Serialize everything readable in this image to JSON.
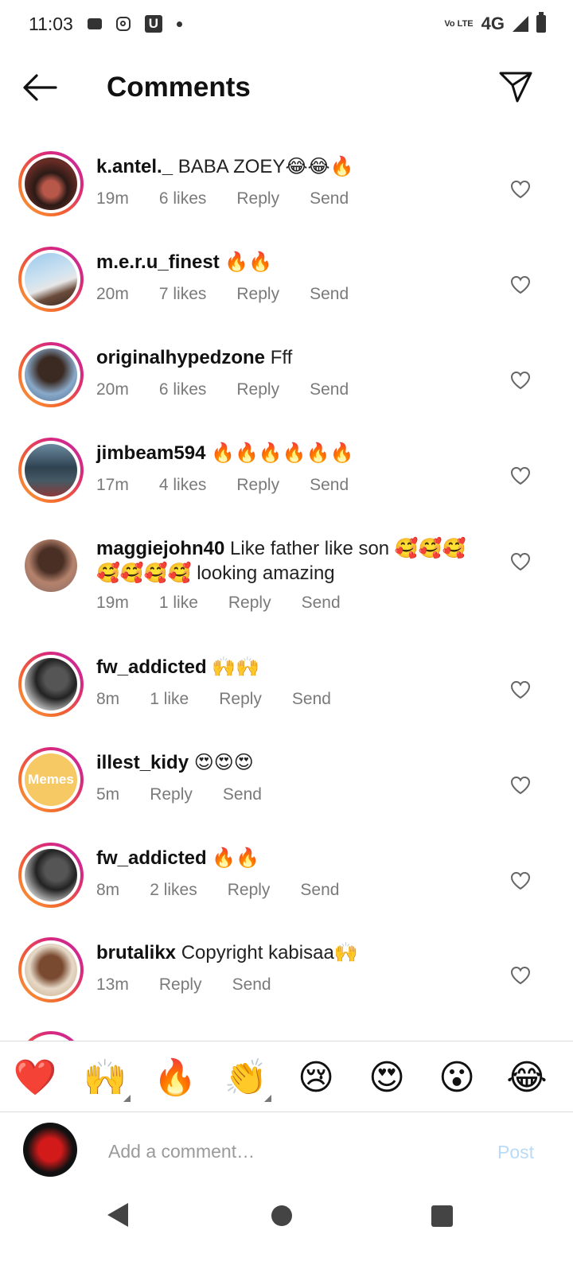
{
  "status_bar": {
    "time": "11:03",
    "network_label": "4G",
    "volte_label": "Vo LTE",
    "notification_icons": [
      "message-icon",
      "instagram-icon",
      "u-app-icon",
      "dot-icon"
    ],
    "system_icons": [
      "volte-icon",
      "signal-icon",
      "battery-icon"
    ]
  },
  "header": {
    "title": "Comments",
    "back_icon": "arrow-left-icon",
    "share_icon": "paper-plane-icon"
  },
  "comments": [
    {
      "username": "k.antel._",
      "text": "BABA ZOEY😂😂🔥",
      "time": "19m",
      "likes": "6 likes",
      "reply": "Reply",
      "send": "Send",
      "has_story_ring": true
    },
    {
      "username": "m.e.r.u_finest",
      "text": "🔥🔥",
      "time": "20m",
      "likes": "7 likes",
      "reply": "Reply",
      "send": "Send",
      "has_story_ring": true
    },
    {
      "username": "originalhypedzone",
      "text": "Fff",
      "time": "20m",
      "likes": "6 likes",
      "reply": "Reply",
      "send": "Send",
      "has_story_ring": true
    },
    {
      "username": "jimbeam594",
      "text": "🔥🔥🔥🔥🔥🔥",
      "time": "17m",
      "likes": "4 likes",
      "reply": "Reply",
      "send": "Send",
      "has_story_ring": true
    },
    {
      "username": "maggiejohn40",
      "text": "Like father like son 🥰🥰🥰🥰🥰🥰🥰 looking amazing",
      "time": "19m",
      "likes": "1 like",
      "reply": "Reply",
      "send": "Send",
      "has_story_ring": false
    },
    {
      "username": "fw_addicted",
      "text": "🙌🙌",
      "time": "8m",
      "likes": "1 like",
      "reply": "Reply",
      "send": "Send",
      "has_story_ring": true
    },
    {
      "username": "illest_kidy",
      "text": "😍😍😍",
      "time": "5m",
      "likes": "",
      "reply": "Reply",
      "send": "Send",
      "has_story_ring": true,
      "avatar_text": "Memes"
    },
    {
      "username": "fw_addicted",
      "text": "🔥🔥",
      "time": "8m",
      "likes": "2 likes",
      "reply": "Reply",
      "send": "Send",
      "has_story_ring": true
    },
    {
      "username": "brutalikx",
      "text": "Copyright kabisaa🙌",
      "time": "13m",
      "likes": "",
      "reply": "Reply",
      "send": "Send",
      "has_story_ring": true
    }
  ],
  "emoji_bar": [
    "❤️",
    "🙌",
    "🔥",
    "👏",
    "😢",
    "😍",
    "😮",
    "😂"
  ],
  "compose": {
    "placeholder": "Add a comment…",
    "post_label": "Post"
  },
  "navbar": {
    "icons": [
      "nav-back-icon",
      "nav-home-icon",
      "nav-recents-icon"
    ]
  },
  "colors": {
    "story_ring_start": "#f9a13d",
    "story_ring_end": "#c42ba8",
    "meta_text": "#7a7a7a",
    "post_disabled": "#b9dbf7"
  }
}
